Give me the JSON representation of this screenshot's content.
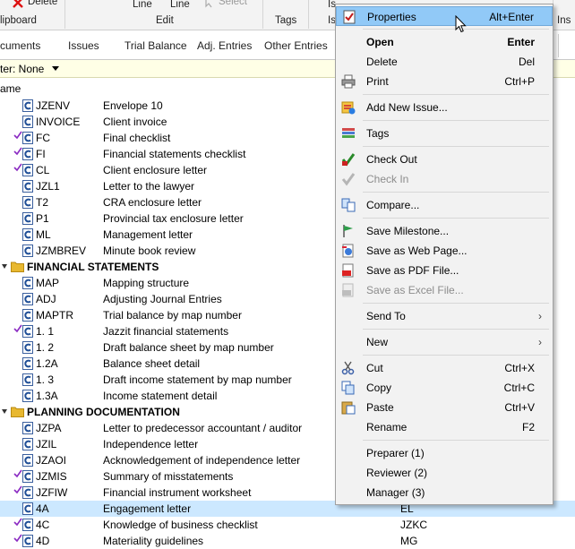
{
  "ribbon": {
    "delete_label": "Delete",
    "clipboard_group": "lipboard",
    "line1": "Line",
    "line2": "Line",
    "select_label": "Select",
    "edit_group": "Edit",
    "tags_group": "Tags",
    "is_top": "Is",
    "is_bottom": "Is",
    "ins_label": "Ins"
  },
  "tabs": [
    "cuments",
    "Issues",
    "Trial Balance",
    "Adj. Entries",
    "Other Entries"
  ],
  "filter": {
    "label": "ter: None"
  },
  "list_header": {
    "name": "ame"
  },
  "rows": [
    {
      "code": "JZENV",
      "desc": "Envelope 10",
      "check": false
    },
    {
      "code": "INVOICE",
      "desc": "Client invoice",
      "check": false
    },
    {
      "code": "FC",
      "desc": "Final checklist",
      "check": true
    },
    {
      "code": "FI",
      "desc": "Financial statements checklist",
      "check": true
    },
    {
      "code": "CL",
      "desc": "Client enclosure letter",
      "check": true
    },
    {
      "code": "JZL1",
      "desc": "Letter to the lawyer",
      "check": false
    },
    {
      "code": "T2",
      "desc": "CRA enclosure letter",
      "check": false
    },
    {
      "code": "P1",
      "desc": "Provincial tax enclosure letter",
      "check": false
    },
    {
      "code": "ML",
      "desc": "Management letter",
      "check": false
    },
    {
      "code": "JZMBREV",
      "desc": "Minute book review",
      "check": false
    }
  ],
  "group1": {
    "name": "FINANCIAL STATEMENTS",
    "rows": [
      {
        "code": "MAP",
        "desc": "Mapping structure",
        "check": false
      },
      {
        "code": "ADJ",
        "desc": "Adjusting Journal Entries",
        "check": false
      },
      {
        "code": "MAPTR",
        "desc": "Trial balance by map number",
        "check": false
      },
      {
        "code": "1. 1",
        "desc": "Jazzit financial statements",
        "check": true
      },
      {
        "code": "1. 2",
        "desc": "Draft balance sheet by map number",
        "check": false
      },
      {
        "code": "1.2A",
        "desc": "Balance sheet detail",
        "check": false
      },
      {
        "code": "1. 3",
        "desc": "Draft income statement by map number",
        "check": false
      },
      {
        "code": "1.3A",
        "desc": "Income statement detail",
        "check": false
      }
    ]
  },
  "group2": {
    "name": "PLANNING DOCUMENTATION",
    "rows": [
      {
        "code": "JZPA",
        "desc": "Letter to predecessor accountant / auditor",
        "check": false,
        "extra": ""
      },
      {
        "code": "JZIL",
        "desc": "Independence letter",
        "check": false,
        "extra": ""
      },
      {
        "code": "JZAOI",
        "desc": "Acknowledgement of independence letter",
        "check": false,
        "extra": ""
      },
      {
        "code": "JZMIS",
        "desc": "Summary of misstatements",
        "check": true,
        "extra": ""
      },
      {
        "code": "JZFIW",
        "desc": "Financial instrument worksheet",
        "check": true,
        "extra": ""
      },
      {
        "code": "4A",
        "desc": "Engagement letter",
        "check": false,
        "extra": "EL",
        "selected": true
      },
      {
        "code": "4C",
        "desc": "Knowledge of business checklist",
        "check": true,
        "extra": "JZKC"
      },
      {
        "code": "4D",
        "desc": "Materiality guidelines",
        "check": true,
        "extra": "MG"
      }
    ]
  },
  "menu": {
    "items": [
      {
        "label": "Properties",
        "key": "Alt+Enter",
        "icon": "checklist-icon",
        "highlight": true
      },
      {
        "sep": true
      },
      {
        "label": "Open",
        "key": "Enter",
        "bold": true
      },
      {
        "label": "Delete",
        "key": "Del",
        "icon": "delete-x-icon"
      },
      {
        "label": "Print",
        "key": "Ctrl+P",
        "icon": "printer-icon"
      },
      {
        "sep": true
      },
      {
        "label": "Add New Issue...",
        "key": "",
        "icon": "add-issue-icon"
      },
      {
        "sep": true
      },
      {
        "label": "Tags",
        "key": "",
        "icon": "tags-icon"
      },
      {
        "sep": true
      },
      {
        "label": "Check Out",
        "key": "",
        "icon": "check-out-icon"
      },
      {
        "label": "Check In",
        "key": "",
        "icon": "check-in-icon",
        "disabled": true
      },
      {
        "sep": true
      },
      {
        "label": "Compare...",
        "key": "",
        "icon": "compare-icon"
      },
      {
        "sep": true
      },
      {
        "label": "Save Milestone...",
        "key": "",
        "icon": "milestone-flag-icon"
      },
      {
        "label": "Save as Web Page...",
        "key": "",
        "icon": "web-page-icon"
      },
      {
        "label": "Save as PDF File...",
        "key": "",
        "icon": "pdf-icon"
      },
      {
        "label": "Save as Excel File...",
        "key": "",
        "icon": "excel-icon",
        "disabled": true
      },
      {
        "sep": true
      },
      {
        "label": "Send To",
        "key": "",
        "submenu": true
      },
      {
        "sep": true
      },
      {
        "label": "New",
        "key": "",
        "submenu": true
      },
      {
        "sep": true
      },
      {
        "label": "Cut",
        "key": "Ctrl+X",
        "icon": "scissors-icon"
      },
      {
        "label": "Copy",
        "key": "Ctrl+C",
        "icon": "copy-icon"
      },
      {
        "label": "Paste",
        "key": "Ctrl+V",
        "icon": "paste-icon"
      },
      {
        "label": "Rename",
        "key": "F2"
      },
      {
        "sep": true
      },
      {
        "label": "Preparer (1)",
        "key": ""
      },
      {
        "label": "Reviewer (2)",
        "key": ""
      },
      {
        "label": "Manager (3)",
        "key": ""
      }
    ]
  },
  "colors": {
    "checkmark": "#8a2ac2",
    "doc_icon_blue": "#1f4e96",
    "folder_yellow": "#e8b830",
    "selection": "#cce8ff",
    "menu_highlight": "#91c9f7"
  }
}
